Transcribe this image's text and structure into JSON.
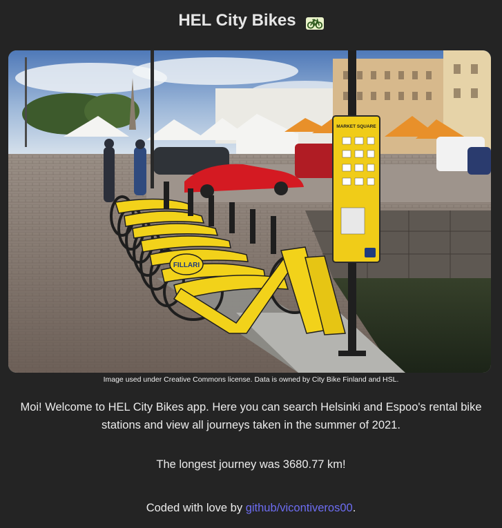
{
  "header": {
    "title": "HEL City Bikes",
    "icon": "bicycle-icon"
  },
  "hero": {
    "image_alt": "Yellow city bikes docked at Market Square, Helsinki",
    "station_sign": "MARKET SQUARE",
    "bike_brand": "FILLARI",
    "caption": "Image used under Creative Commons license. Data is owned by City Bike Finland and HSL."
  },
  "intro": {
    "text": "Moi! Welcome to HEL City Bikes app. Here you can search Helsinki and Espoo's rental bike stations and view all journeys taken in the summer of 2021."
  },
  "stats": {
    "longest_journey": "The longest journey was 3680.77 km!"
  },
  "footer": {
    "prefix": "Coded with love by ",
    "link_text": "github/vicontiveros00",
    "suffix": "."
  },
  "colors": {
    "background": "#242424",
    "link": "#6d6df2",
    "bike_yellow": "#f2d21a"
  }
}
